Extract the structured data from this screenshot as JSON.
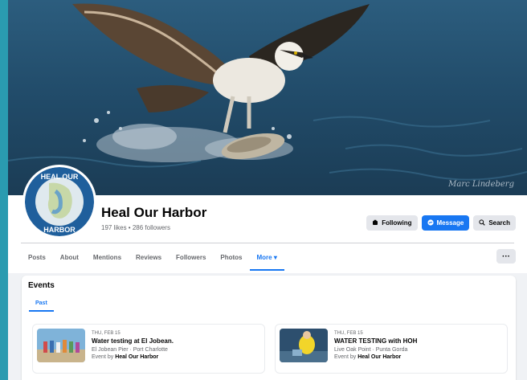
{
  "cover": {
    "credit": "Marc Lindeberg"
  },
  "page": {
    "name": "Heal Our Harbor",
    "stats": "197 likes • 286 followers",
    "logo_text_top": "HEAL OUR",
    "logo_text_bottom": "HARBOR"
  },
  "actions": {
    "following": "Following",
    "message": "Message",
    "search": "Search"
  },
  "tabs": [
    "Posts",
    "About",
    "Mentions",
    "Reviews",
    "Followers",
    "Photos",
    "More ▾"
  ],
  "more_button": "···",
  "events": {
    "title": "Events",
    "subtab": "Past",
    "items": [
      {
        "date": "THU, FEB 15",
        "title": "Water testing at El Jobean.",
        "location": "El Jobean Pier · Port Charlotte",
        "by_prefix": "Event by",
        "by": "Heal Our Harbor"
      },
      {
        "date": "THU, FEB 15",
        "title": "WATER TESTING with HOH",
        "location": "Live Oak Point · Punta Gorda",
        "by_prefix": "Event by",
        "by": "Heal Our Harbor"
      }
    ]
  },
  "colors": {
    "accent": "#1877f2",
    "background": "#f0f2f5",
    "frame": "#2a9bb0"
  }
}
